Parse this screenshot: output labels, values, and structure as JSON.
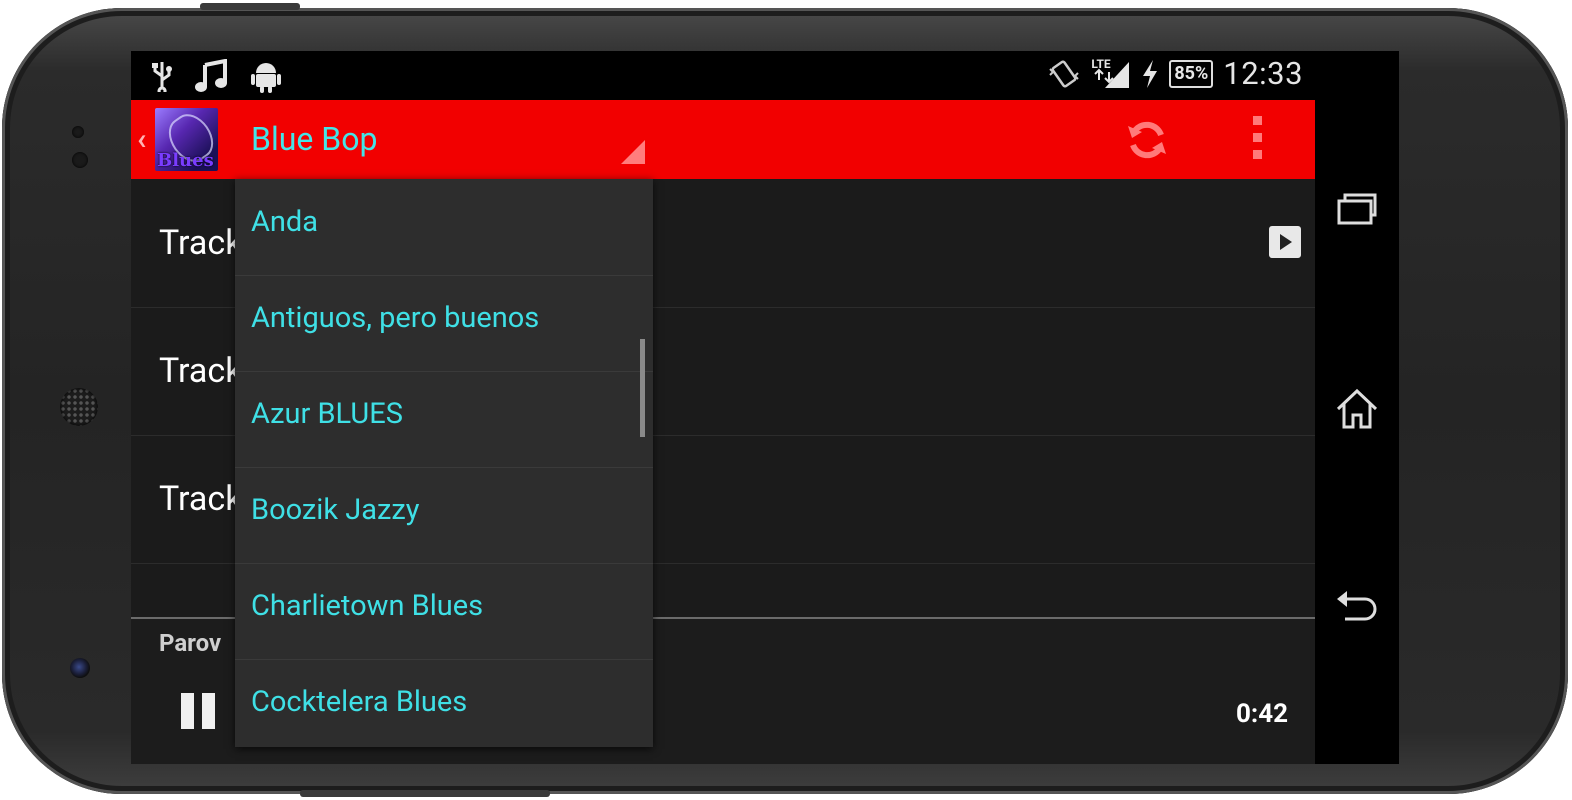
{
  "status_bar": {
    "battery": "85%",
    "network": "LTE",
    "time": "12:33",
    "left_icons": [
      "usb-icon",
      "music-note-icon",
      "android-icon"
    ],
    "right_icons": [
      "vibrate-icon",
      "signal-icon",
      "charging-icon",
      "battery-icon"
    ]
  },
  "action_bar": {
    "title": "Blue Bop",
    "app_icon_text": "Blues",
    "refresh_icon": "refresh-icon",
    "overflow_icon": "overflow-menu-icon",
    "accent_color": "#f20000"
  },
  "tracks": [
    {
      "label": "Track"
    },
    {
      "label": "Track"
    },
    {
      "label": "Track"
    }
  ],
  "player": {
    "artist": "Parov",
    "elapsed": "0:42"
  },
  "dropdown": {
    "items": [
      {
        "label": "Anda"
      },
      {
        "label": "Antiguos, pero buenos"
      },
      {
        "label": "Azur BLUES"
      },
      {
        "label": "Boozik Jazzy"
      },
      {
        "label": "Charlietown Blues"
      },
      {
        "label": "Cocktelera Blues"
      }
    ]
  },
  "nav_bar": {
    "icons": [
      "recent-apps-icon",
      "home-icon",
      "back-icon"
    ]
  }
}
